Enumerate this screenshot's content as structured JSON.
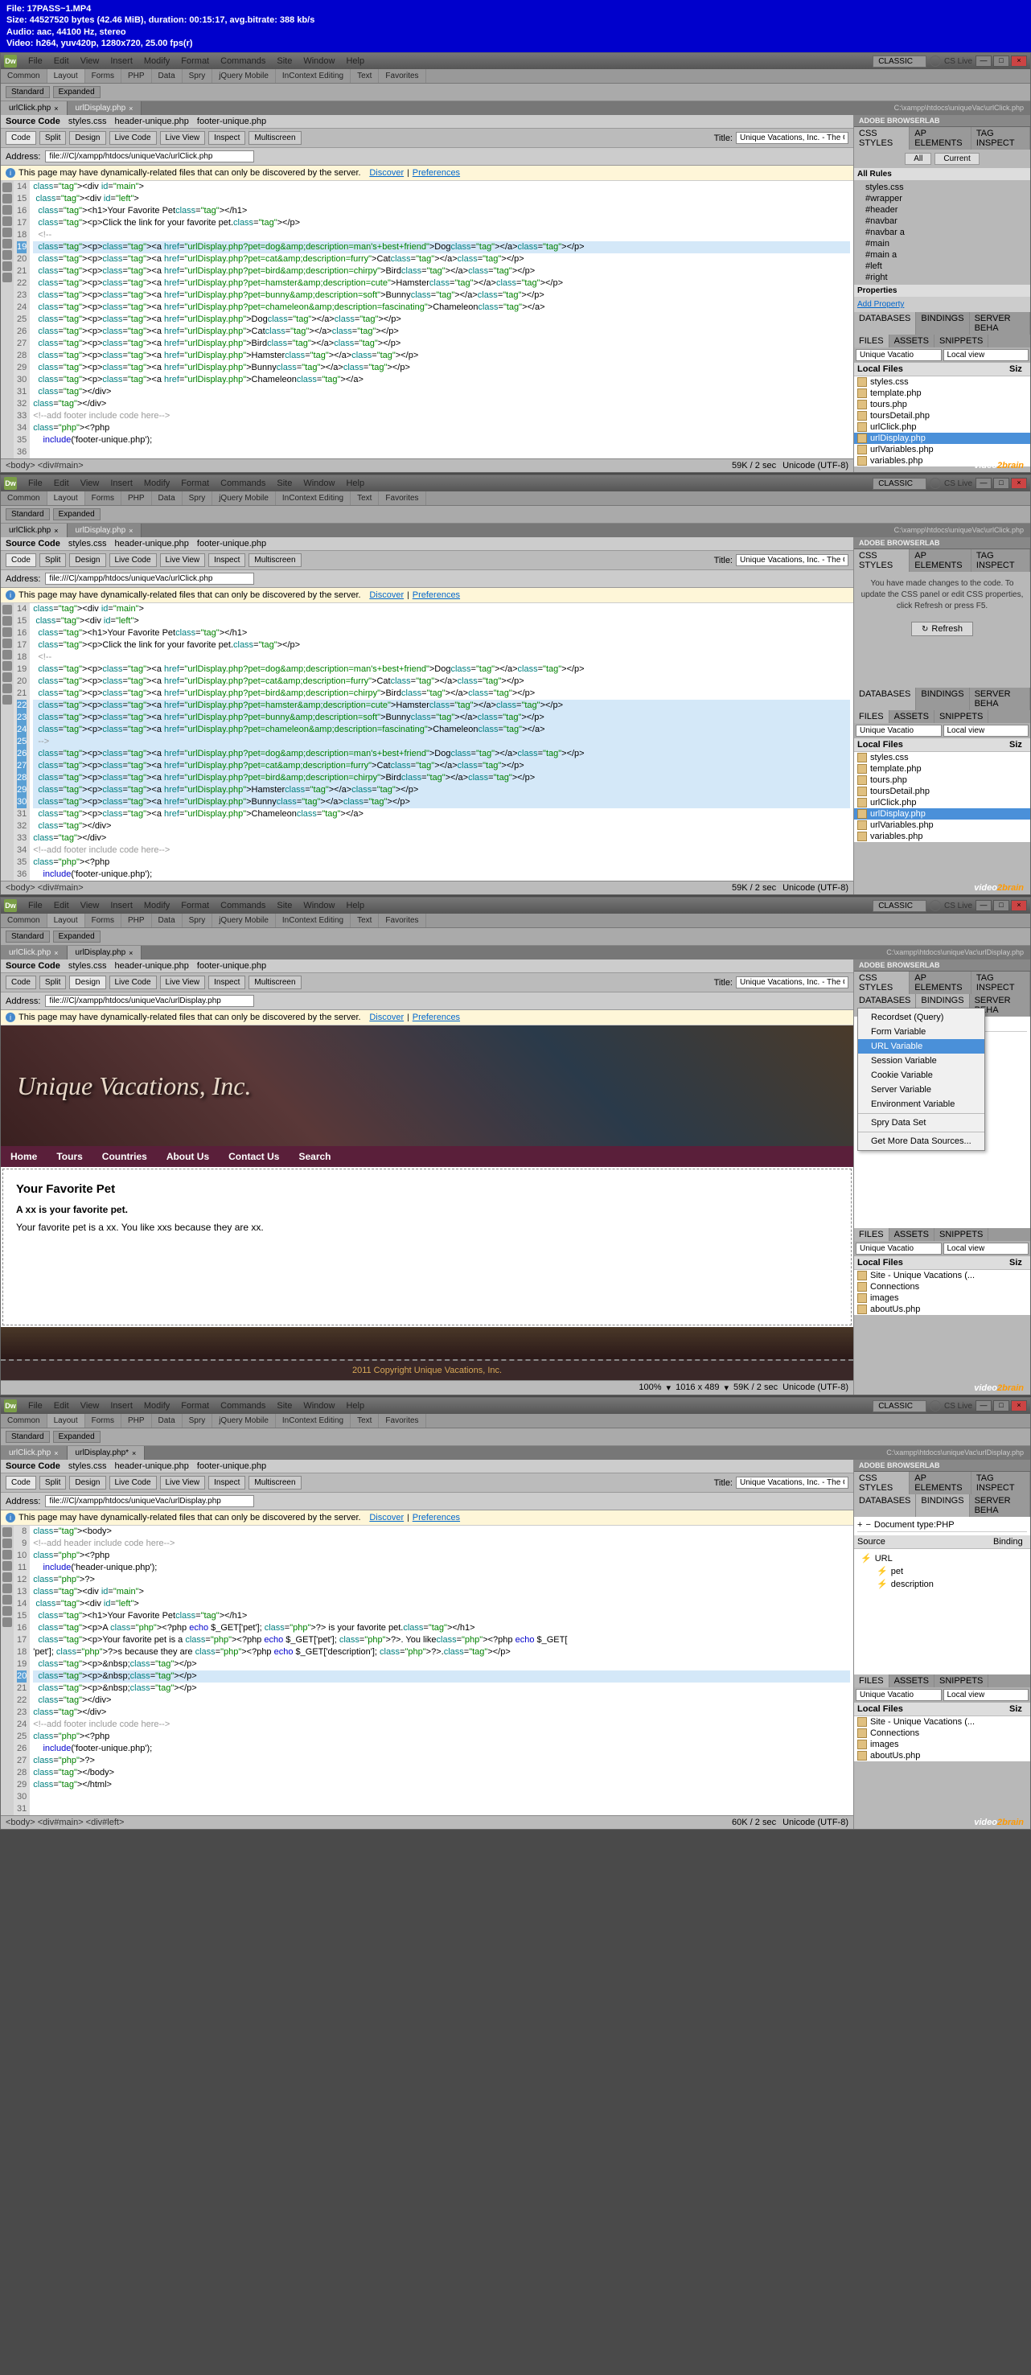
{
  "video": {
    "file": "File: 17PASS~1.MP4",
    "size": "Size: 44527520 bytes (42.46 MiB), duration: 00:15:17, avg.bitrate: 388 kb/s",
    "audio": "Audio: aac, 44100 Hz, stereo",
    "vcodec": "Video: h264, yuv420p, 1280x720, 25.00 fps(r)"
  },
  "menu": [
    "File",
    "Edit",
    "View",
    "Insert",
    "Modify",
    "Format",
    "Commands",
    "Site",
    "Window",
    "Help"
  ],
  "layout_dd": "CLASSIC",
  "cslive": "CS Live",
  "insert_tabs": [
    "Common",
    "Layout",
    "Forms",
    "PHP",
    "Data",
    "Spry",
    "jQuery Mobile",
    "InContext Editing",
    "Text",
    "Favorites"
  ],
  "sub_btns": [
    "Standard",
    "Expanded"
  ],
  "w1": {
    "tabs": [
      {
        "n": "urlClick.php",
        "a": true
      },
      {
        "n": "urlDisplay.php"
      }
    ],
    "path": "C:\\xampp\\htdocs\\uniqueVac\\urlClick.php",
    "related": [
      "Source Code",
      "styles.css",
      "header-unique.php",
      "footer-unique.php"
    ],
    "views": [
      "Code",
      "Split",
      "Design"
    ],
    "view_active": "Code",
    "live": [
      "Live Code",
      "Live View",
      "Inspect",
      "Multiscreen"
    ],
    "title_lbl": "Title:",
    "title": "Unique Vacations, Inc. - The G",
    "addr_lbl": "Address:",
    "addr": "file:///C|/xampp/htdocs/uniqueVac/urlClick.php",
    "info": "This page may have dynamically-related files that can only be discovered by the server.",
    "info_links": [
      "Discover",
      "Preferences"
    ],
    "lines": [
      "14",
      "15",
      "16",
      "17",
      "18",
      "19",
      "20",
      "21",
      "22",
      "23",
      "24",
      "25",
      "26",
      "27",
      "28",
      "29",
      "30",
      "31",
      "32",
      "33",
      "34",
      "35",
      "36"
    ],
    "hl": 19,
    "code": [
      "<div id=\"main\">",
      " <div id=\"left\">",
      "  <h1>Your Favorite Pet</h1>",
      "  <p>Click the link for your favorite pet.</p>",
      "  <!--",
      "  <p><a href=\"urlDisplay.php?pet=dog&amp;description=man's+best+friend\">Dog</a></p>",
      "  <p><a href=\"urlDisplay.php?pet=cat&amp;description=furry\">Cat</a></p>",
      "  <p><a href=\"urlDisplay.php?pet=bird&amp;description=chirpy\">Bird</a></p>",
      "  <p><a href=\"urlDisplay.php?pet=hamster&amp;description=cute\">Hamster</a></p>",
      "  <p><a href=\"urlDisplay.php?pet=bunny&amp;description=soft\">Bunny</a></p>",
      "  <p><a href=\"urlDisplay.php?pet=chameleon&amp;description=fascinating\">Chameleon</a>",
      "  <p><a href=\"urlDisplay.php\">Dog</a></p>",
      "  <p><a href=\"urlDisplay.php\">Cat</a></p>",
      "  <p><a href=\"urlDisplay.php\">Bird</a></p>",
      "  <p><a href=\"urlDisplay.php\">Hamster</a></p>",
      "  <p><a href=\"urlDisplay.php\">Bunny</a></p>",
      "  <p><a href=\"urlDisplay.php\">Chameleon</a>",
      "  </div>",
      "",
      "</div>",
      "<!--add footer include code here-->",
      "<?php",
      "    include('footer-unique.php');"
    ],
    "status_path": "<body> <div#main>",
    "status_right": [
      "59K / 2 sec",
      "Unicode (UTF-8)"
    ],
    "css": {
      "hdr": "CSS STYLES",
      "tabs": [
        "CSS STYLES",
        "AP ELEMENTS",
        "TAG INSPECT"
      ],
      "mode": [
        "All",
        "Current"
      ],
      "rules_hdr": "All Rules",
      "tree": [
        "styles.css",
        "  #wrapper",
        "  #header",
        "  #navbar",
        "  #navbar a",
        "  #main",
        "  #main a",
        "  #left",
        "  #right"
      ],
      "props": "Properties",
      "add": "Add Property"
    },
    "db": {
      "tabs": [
        "DATABASES",
        "BINDINGS",
        "SERVER BEHA"
      ]
    },
    "files": {
      "tabs": [
        "FILES",
        "ASSETS",
        "SNIPPETS"
      ],
      "site": "Unique Vacatio",
      "view": "Local view",
      "hdr": "Local Files",
      "cols": [
        "",
        "Siz"
      ],
      "rows": [
        "styles.css",
        "template.php",
        "tours.php",
        "toursDetail.php",
        "urlClick.php",
        "urlDisplay.php",
        "urlVariables.php",
        "variables.php"
      ],
      "sel": 5
    }
  },
  "w2": {
    "tabs": [
      {
        "n": "urlClick.php",
        "a": true
      },
      {
        "n": "urlDisplay.php"
      }
    ],
    "path": "C:\\xampp\\htdocs\\uniqueVac\\urlClick.php",
    "lines": [
      "14",
      "15",
      "16",
      "17",
      "18",
      "19",
      "20",
      "21",
      "22",
      "23",
      "24",
      "25",
      "26",
      "27",
      "28",
      "29",
      "30",
      "31",
      "32",
      "33",
      "34",
      "35",
      "36"
    ],
    "hl_from": 22,
    "hl_to": 30,
    "code": [
      "<div id=\"main\">",
      " <div id=\"left\">",
      "  <h1>Your Favorite Pet</h1>",
      "  <p>Click the link for your favorite pet.</p>",
      "  <!--",
      "  <p><a href=\"urlDisplay.php?pet=dog&amp;description=man's+best+friend\">Dog</a></p>",
      "  <p><a href=\"urlDisplay.php?pet=cat&amp;description=furry\">Cat</a></p>",
      "  <p><a href=\"urlDisplay.php?pet=bird&amp;description=chirpy\">Bird</a></p>",
      "  <p><a href=\"urlDisplay.php?pet=hamster&amp;description=cute\">Hamster</a></p>",
      "  <p><a href=\"urlDisplay.php?pet=bunny&amp;description=soft\">Bunny</a></p>",
      "  <p><a href=\"urlDisplay.php?pet=chameleon&amp;description=fascinating\">Chameleon</a>",
      "  -->",
      "  <p><a href=\"urlDisplay.php?pet=dog&amp;description=man's+best+friend\">Dog</a></p>",
      "  <p><a href=\"urlDisplay.php?pet=cat&amp;description=furry\">Cat</a></p>",
      "  <p><a href=\"urlDisplay.php?pet=bird&amp;description=chirpy\">Bird</a></p>",
      "  <p><a href=\"urlDisplay.php\">Hamster</a></p>",
      "  <p><a href=\"urlDisplay.php\">Bunny</a></p>",
      "  <p><a href=\"urlDisplay.php\">Chameleon</a>",
      "  </div>",
      "",
      "</div>",
      "<!--add footer include code here-->",
      "<?php",
      "    include('footer-unique.php');"
    ],
    "css_msg": "You have made changes to the code. To update the CSS panel or edit CSS properties, click Refresh or press F5.",
    "refresh": "Refresh"
  },
  "w3": {
    "tabs": [
      {
        "n": "urlClick.php"
      },
      {
        "n": "urlDisplay.php",
        "a": true
      }
    ],
    "path": "C:\\xampp\\htdocs\\uniqueVac\\urlDisplay.php",
    "view_active": "Design",
    "addr": "file:///C|/xampp/htdocs/uniqueVac/urlDisplay.php",
    "title": "Unique Vacations, Inc. - The G",
    "banner": "Unique Vacations, Inc.",
    "nav": [
      "Home",
      "Tours",
      "Countries",
      "About Us",
      "Contact Us",
      "Search"
    ],
    "h1": "Your Favorite Pet",
    "p1": "A xx is your favorite pet.",
    "p2": "Your favorite pet is a xx. You like xxs because they are xx.",
    "footer": "2011 Copyright Unique Vacations, Inc.",
    "design_status": [
      "100%",
      "1016 x 489",
      "59K / 2 sec",
      "Unicode (UTF-8)"
    ],
    "bindings": {
      "doctype": "Document type:PHP",
      "menu": [
        "Recordset (Query)",
        "Form Variable",
        "URL Variable",
        "Session Variable",
        "Cookie Variable",
        "Server Variable",
        "Environment Variable",
        "Spry Data Set",
        "Get More Data Sources..."
      ],
      "hov": 2
    },
    "files": {
      "site": "Unique Vacatio",
      "view": "Local view",
      "rows": [
        "Site - Unique Vacations (...",
        "Connections",
        "images",
        "aboutUs.php"
      ]
    }
  },
  "w4": {
    "tabs": [
      {
        "n": "urlClick.php"
      },
      {
        "n": "urlDisplay.php*",
        "a": true
      }
    ],
    "path": "C:\\xampp\\htdocs\\uniqueVac\\urlDisplay.php",
    "title": "Unique Vacations, Inc. - The G",
    "addr": "file:///C|/xampp/htdocs/uniqueVac/urlDisplay.php",
    "lines": [
      "8",
      "9",
      "10",
      "11",
      "12",
      "13",
      "14",
      "15",
      "16",
      "17",
      "18",
      "19",
      "20",
      "21",
      "22",
      "23",
      "24",
      "25",
      "26",
      "27",
      "28",
      "29",
      "30",
      "31"
    ],
    "hl": 20,
    "code": [
      "<body>",
      "<!--add header include code here-->",
      "<?php",
      "    include('header-unique.php');",
      "?>",
      "<div id=\"main\">",
      " <div id=\"left\">",
      "  <h1>Your Favorite Pet</h1>",
      "  <p>A <?php echo $_GET['pet']; ?> is your favorite pet.</h1>",
      "  <p>Your favorite pet is a <?php echo $_GET['pet']; ?>. You like<?php echo $_GET[",
      "'pet']; ?>s because they are <?php echo $_GET['description']; ?>.</p>",
      "  <p>&nbsp;</p>",
      "  <p>&nbsp;</p>",
      "  <p>&nbsp;</p>",
      "",
      "  </div>",
      "",
      "</div>",
      "<!--add footer include code here-->",
      "<?php",
      "    include('footer-unique.php');",
      "?>",
      "</body>",
      "</html>"
    ],
    "status_path": "<body> <div#main> <div#left>",
    "status_right": [
      "60K / 2 sec",
      "Unicode (UTF-8)"
    ],
    "bindings": {
      "doctype": "Document type:PHP",
      "cols": [
        "Source",
        "Binding"
      ],
      "tree": [
        "URL",
        "pet",
        "description"
      ]
    },
    "files": {
      "rows": [
        "Site - Unique Vacations (...",
        "Connections",
        "images",
        "aboutUs.php"
      ]
    }
  },
  "browserlab": "ADOBE BROWSERLAB",
  "watermark": "video2brain"
}
